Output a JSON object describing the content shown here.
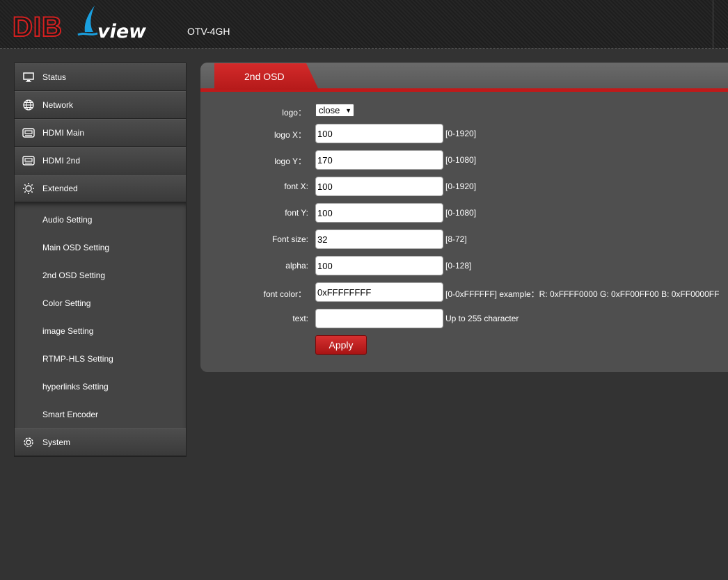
{
  "header": {
    "logo_text_dib": "DIB",
    "logo_text_view": "view",
    "model": "OTV-4GH"
  },
  "sidebar": {
    "items": [
      {
        "label": "Status",
        "icon": "monitor-icon"
      },
      {
        "label": "Network",
        "icon": "globe-icon"
      },
      {
        "label": "HDMI Main",
        "icon": "hdmi-icon"
      },
      {
        "label": "HDMI 2nd",
        "icon": "hdmi-icon"
      },
      {
        "label": "Extended",
        "icon": "sun-gear-icon"
      }
    ],
    "sub_items": [
      "Audio Setting",
      "Main OSD Setting",
      "2nd OSD Setting",
      "Color Setting",
      "image Setting",
      "RTMP-HLS Setting",
      "hyperlinks Setting",
      "Smart Encoder"
    ],
    "system": {
      "label": "System",
      "icon": "gear-icon"
    }
  },
  "panel": {
    "tab": "2nd OSD",
    "logo": {
      "label": "logo：",
      "value": "close"
    },
    "fields": [
      {
        "label": "logo X：",
        "value": "100",
        "hint": "[0-1920]"
      },
      {
        "label": "logo Y：",
        "value": "170",
        "hint": "[0-1080]"
      },
      {
        "label": "font X:",
        "value": "100",
        "hint": "[0-1920]"
      },
      {
        "label": "font Y:",
        "value": "100",
        "hint": "[0-1080]"
      },
      {
        "label": "Font size:",
        "value": "32",
        "hint": "[8-72]"
      },
      {
        "label": "alpha:",
        "value": "100",
        "hint": "[0-128]"
      },
      {
        "label": "font color：",
        "value": "0xFFFFFFFF",
        "hint": "[0-0xFFFFFF] example：R: 0xFFFF0000 G: 0xFF00FF00 B: 0xFF0000FF"
      },
      {
        "label": "text:",
        "value": "",
        "hint": "Up to 255 character"
      }
    ],
    "apply": "Apply"
  },
  "colors": {
    "accent_red": "#c01a1a",
    "background": "#333333",
    "panel": "#4f4f4f"
  }
}
